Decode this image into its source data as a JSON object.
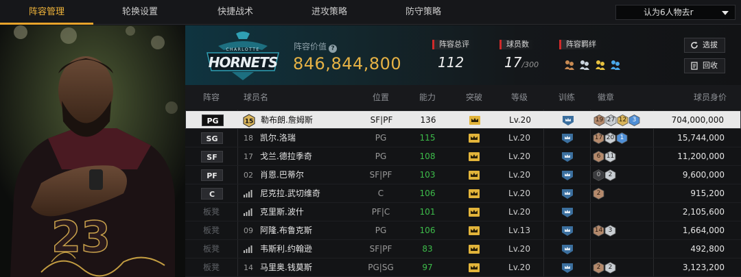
{
  "tabs": [
    {
      "label": "阵容管理",
      "active": true
    },
    {
      "label": "轮换设置",
      "active": false
    },
    {
      "label": "快捷战术",
      "active": false
    },
    {
      "label": "进攻策略",
      "active": false
    },
    {
      "label": "防守策略",
      "active": false
    }
  ],
  "strategy_select": {
    "value": "认为6人物去r"
  },
  "team": {
    "logo_text": "CHARLOTTE HORNETS",
    "value_label": "阵容价值",
    "value": "846,844,800",
    "rating_label": "阵容总评",
    "rating": "112",
    "count_label": "球员数",
    "count": "17",
    "count_max": "/300",
    "bonds_label": "阵容羁绊",
    "bond_icons": [
      "bond-icon-1",
      "bond-icon-2",
      "bond-icon-3",
      "bond-icon-4"
    ],
    "select_button": "选拔",
    "recycle_button": "回收"
  },
  "columns": [
    "阵容",
    "球员名",
    "位置",
    "能力",
    "突破",
    "等级",
    "训练",
    "徽章",
    "球员身价"
  ],
  "colors": {
    "accent": "#e8a42a",
    "ability_green": "#3dbd4a",
    "value_gold": "#e6b245"
  },
  "rows": [
    {
      "slot": "PG",
      "starter": true,
      "number": "15",
      "name": "勒布朗.詹姆斯",
      "position": "SF|PF",
      "ability": "136",
      "level": "Lv.20",
      "badges": [
        {
          "n": "19",
          "c": "bronze"
        },
        {
          "n": "27",
          "c": "silver"
        },
        {
          "n": "12",
          "c": "gold"
        },
        {
          "n": "3",
          "c": "blue"
        }
      ],
      "value": "704,000,000",
      "selected": true
    },
    {
      "slot": "SG",
      "starter": true,
      "number": "18",
      "name": "凯尔.洛瑞",
      "position": "PG",
      "ability": "115",
      "level": "Lv.20",
      "badges": [
        {
          "n": "17",
          "c": "bronze"
        },
        {
          "n": "20",
          "c": "silver"
        },
        {
          "n": "1",
          "c": "blue"
        }
      ],
      "value": "15,744,000"
    },
    {
      "slot": "SF",
      "starter": true,
      "number": "17",
      "name": "戈兰.德拉季奇",
      "position": "PG",
      "ability": "108",
      "level": "Lv.20",
      "badges": [
        {
          "n": "6",
          "c": "bronze"
        },
        {
          "n": "11",
          "c": "silver"
        }
      ],
      "value": "11,200,000"
    },
    {
      "slot": "PF",
      "starter": true,
      "number": "02",
      "name": "肖恩.巴蒂尔",
      "position": "SF|PF",
      "ability": "103",
      "level": "Lv.20",
      "badges": [
        {
          "n": "0",
          "c": "dark"
        },
        {
          "n": "2",
          "c": "silver"
        }
      ],
      "value": "9,600,000"
    },
    {
      "slot": "C",
      "starter": true,
      "number": "",
      "name": "尼克拉.武切维奇",
      "position": "C",
      "ability": "106",
      "level": "Lv.20",
      "badges": [
        {
          "n": "2",
          "c": "bronze"
        }
      ],
      "value": "915,200"
    },
    {
      "slot": "板凳",
      "starter": false,
      "number": "",
      "name": "克里斯.波什",
      "position": "PF|C",
      "ability": "101",
      "level": "Lv.20",
      "badges": [],
      "value": "2,105,600"
    },
    {
      "slot": "板凳",
      "starter": false,
      "number": "09",
      "name": "阿隆.布鲁克斯",
      "position": "PG",
      "ability": "106",
      "level": "Lv.13",
      "badges": [
        {
          "n": "14",
          "c": "bronze"
        },
        {
          "n": "3",
          "c": "silver"
        }
      ],
      "value": "1,664,000"
    },
    {
      "slot": "板凳",
      "starter": false,
      "number": "",
      "name": "韦斯利.约翰逊",
      "position": "SF|PF",
      "ability": "83",
      "level": "Lv.20",
      "badges": [],
      "value": "492,800"
    },
    {
      "slot": "板凳",
      "starter": false,
      "number": "14",
      "name": "马里奥.钱莫斯",
      "position": "PG|SG",
      "ability": "97",
      "level": "Lv.20",
      "badges": [
        {
          "n": "2",
          "c": "bronze"
        },
        {
          "n": "2",
          "c": "silver"
        }
      ],
      "value": "3,123,200"
    }
  ]
}
